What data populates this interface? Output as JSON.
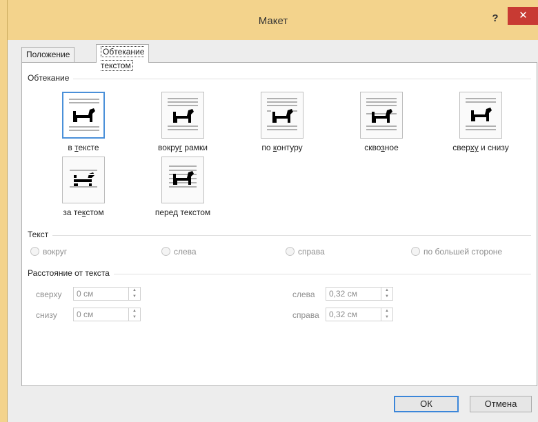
{
  "window": {
    "title": "Макет",
    "help_label": "?",
    "close_label": "✕"
  },
  "tabs": [
    {
      "label": "Положение"
    },
    {
      "label": "Обтекание текстом"
    }
  ],
  "wrapping": {
    "title": "Обтекание",
    "options": [
      {
        "label_pre": "в ",
        "label_key": "т",
        "label_post": "ексте",
        "icon": "inline-with-text-icon"
      },
      {
        "label_pre": "вокру",
        "label_key": "г",
        "label_post": " рамки",
        "icon": "square-wrap-icon"
      },
      {
        "label_pre": "по ",
        "label_key": "к",
        "label_post": "онтуру",
        "icon": "tight-wrap-icon"
      },
      {
        "label_pre": "скво",
        "label_key": "з",
        "label_post": "ное",
        "icon": "through-wrap-icon"
      },
      {
        "label_pre": "свер",
        "label_key": "ху",
        "label_post": " и снизу",
        "icon": "top-bottom-wrap-icon"
      },
      {
        "label_pre": "за те",
        "label_key": "к",
        "label_post": "стом",
        "icon": "behind-text-icon"
      },
      {
        "label_pre": "пере",
        "label_key": "д",
        "label_post": " текстом",
        "icon": "in-front-of-text-icon"
      }
    ]
  },
  "text_group": {
    "title": "Текст",
    "options": [
      {
        "label": "вокруг"
      },
      {
        "label": "слева"
      },
      {
        "label": "справа"
      },
      {
        "label": "по большей стороне"
      }
    ]
  },
  "distance": {
    "title": "Расстояние от текста",
    "top": {
      "label": "сверху",
      "value": "0 см"
    },
    "bottom": {
      "label": "снизу",
      "value": "0 см"
    },
    "left": {
      "label": "слева",
      "value": "0,32 см"
    },
    "right": {
      "label": "справа",
      "value": "0,32 см"
    }
  },
  "buttons": {
    "ok": "ОК",
    "cancel": "Отмена"
  }
}
